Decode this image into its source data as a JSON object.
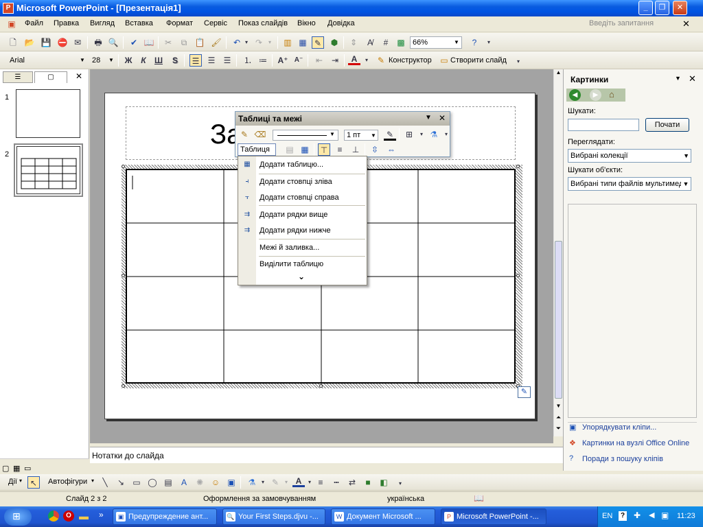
{
  "window": {
    "title": "Microsoft PowerPoint - [Презентація1]"
  },
  "menu": [
    "Файл",
    "Правка",
    "Вигляд",
    "Вставка",
    "Формат",
    "Сервіс",
    "Показ слайдів",
    "Вікно",
    "Довідка"
  ],
  "ask_placeholder": "Введіть запитання",
  "toolbar": {
    "zoom": "66%"
  },
  "format": {
    "font": "Arial",
    "size": "28",
    "bold": "Ж",
    "italic": "К",
    "underline": "Ш",
    "shadow": "S",
    "designer": "Конструктор",
    "new_slide": "Створити слайд"
  },
  "slides": {
    "panel_tabs": [
      "outline-tab",
      "slides-tab"
    ],
    "numbers": [
      "1",
      "2"
    ]
  },
  "slide": {
    "title_placeholder_fragment": "За"
  },
  "table_toolbar": {
    "title": "Таблиці та межі",
    "line_weight": "1 пт",
    "table_menu": "Таблиця"
  },
  "table_menu_items": [
    "Додати таблицю...",
    "Додати стовпці зліва",
    "Додати стовпці справа",
    "Додати рядки вище",
    "Додати рядки нижче",
    "Межі й заливка...",
    "Виділити таблицю"
  ],
  "notes_placeholder": "Нотатки до слайда",
  "taskpane": {
    "title": "Картинки",
    "search_label": "Шукати:",
    "search_value": "",
    "go_button": "Почати",
    "browse_label": "Переглядати:",
    "browse_value": "Вибрані колекції",
    "find_objects_label": "Шукати об'єкти:",
    "find_objects_value": "Вибрані типи файлів мультимеді",
    "links": [
      "Упорядкувати кліпи...",
      "Картинки на вузлі Office Online",
      "Поради з пошуку кліпів"
    ]
  },
  "drawing": {
    "actions": "Дії",
    "autoshapes": "Автофігури"
  },
  "status": {
    "slide": "Слайд 2 з 2",
    "design": "Оформлення за замовчуванням",
    "language": "українська"
  },
  "taskbar": {
    "tasks": [
      "Предупреждение ант...",
      "Your First Steps.djvu -...",
      "Документ Microsoft ...",
      "Microsoft PowerPoint -..."
    ],
    "lang": "EN",
    "time": "11:23"
  },
  "colors": {
    "title_bar": "#0a5ce0",
    "taskbar": "#245edb",
    "font_color_bar": "#d40000",
    "slide_bg": "#a3a3a3"
  }
}
